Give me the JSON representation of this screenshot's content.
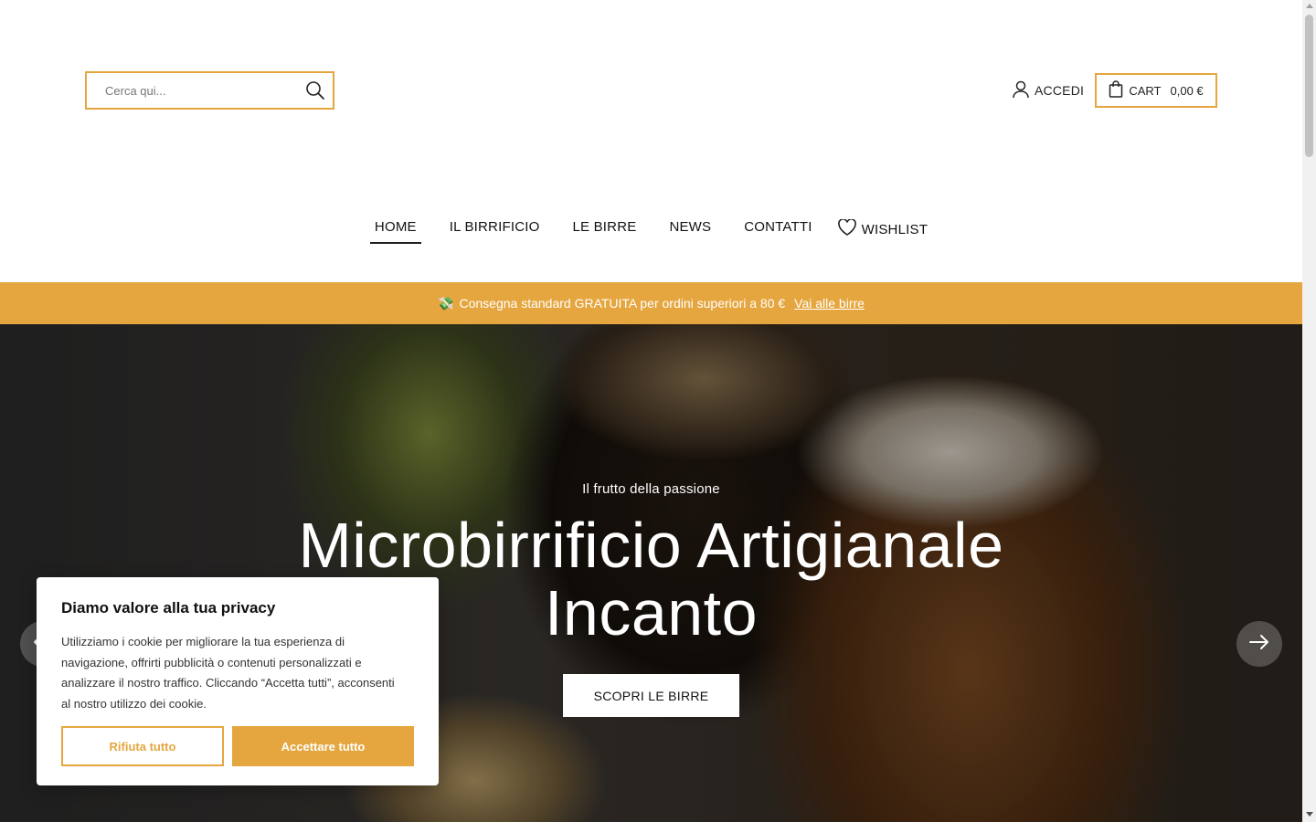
{
  "header": {
    "search": {
      "placeholder": "Cerca qui...",
      "icon": "search-icon"
    },
    "login_label": "ACCEDI",
    "cart_label": "CART",
    "cart_value": "0,00 €"
  },
  "nav": {
    "items": [
      {
        "label": "HOME",
        "active": true
      },
      {
        "label": "IL BIRRIFICIO"
      },
      {
        "label": "LE BIRRE"
      },
      {
        "label": "NEWS"
      },
      {
        "label": "CONTATTI"
      },
      {
        "label": "WISHLIST",
        "icon": "heart-icon"
      }
    ]
  },
  "promo": {
    "icon": "💸",
    "text": "Consegna standard GRATUITA per ordini superiori a 80 €",
    "link": "Vai alle birre"
  },
  "hero": {
    "kicker": "Il frutto della passione",
    "title_line1": "Microbirrificio Artigianale",
    "title_line2": "Incanto",
    "cta": "SCOPRI LE BIRRE"
  },
  "cookie": {
    "title": "Diamo valore alla tua privacy",
    "text": "Utilizziamo i cookie per migliorare la tua esperienza di navigazione, offrirti pubblicità o contenuti personalizzati e analizzare il nostro traffico. Cliccando “Accetta tutti”, acconsenti al nostro utilizzo dei cookie.",
    "reject": "Rifiuta tutto",
    "accept": "Accettare tutto"
  },
  "colors": {
    "accent": "#e5a63f"
  }
}
